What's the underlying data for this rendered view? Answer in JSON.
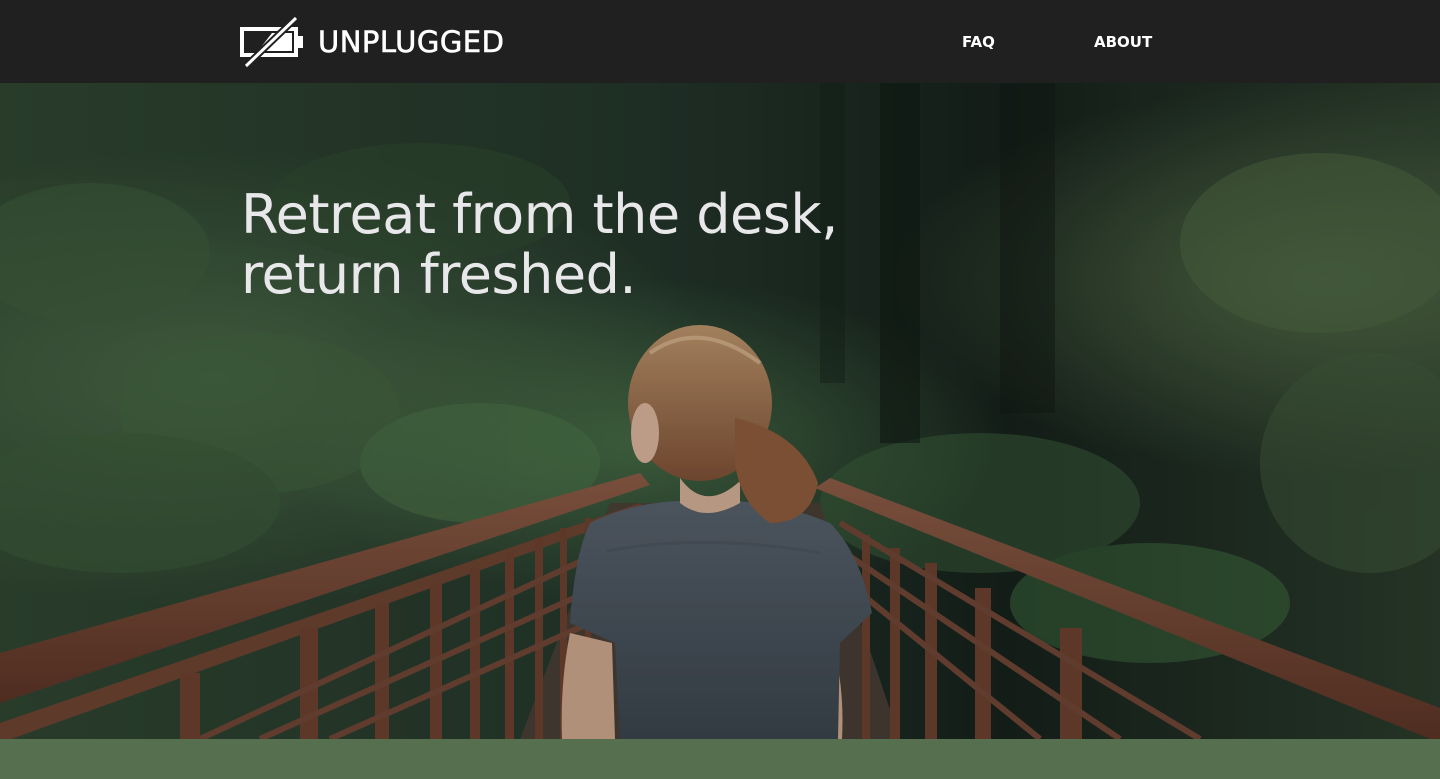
{
  "header": {
    "logo_text": "UNPLUGGED",
    "logo_icon": "unplugged-battery-icon",
    "nav": [
      {
        "label": "FAQ"
      },
      {
        "label": "ABOUT"
      }
    ]
  },
  "hero": {
    "headline_line1": "Retreat from the desk,",
    "headline_line2": "return freshed.",
    "photo": "person-on-wooden-bridge-in-forest"
  },
  "colors": {
    "header_bg": "#202020",
    "band_green": "#56704f",
    "headline_text": "#e8e8ea"
  }
}
